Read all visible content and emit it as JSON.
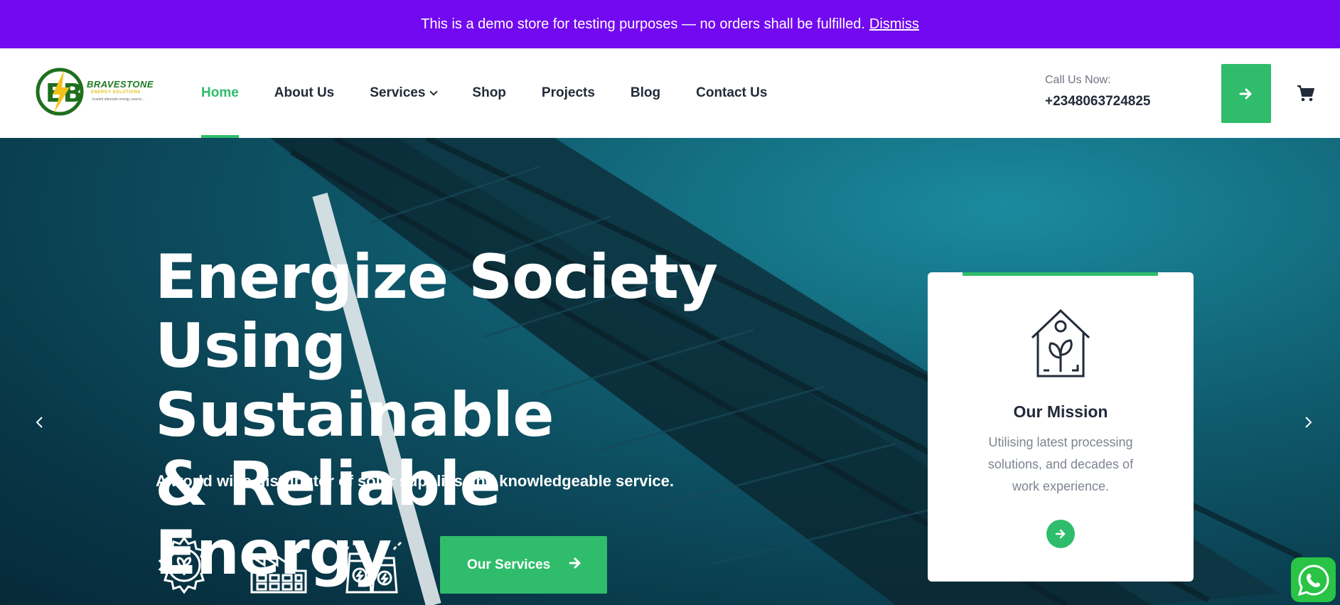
{
  "notice": {
    "text": "This is a demo store for testing purposes — no orders shall be fulfilled.",
    "dismiss": "Dismiss",
    "color": "#7209f0"
  },
  "logo": {
    "brand": "BRAVESTONE",
    "sub": "ENERGY SOLUTIONS",
    "tagline": "trusted alternate energy source..."
  },
  "nav": {
    "items": [
      "Home",
      "About Us",
      "Services",
      "Shop",
      "Projects",
      "Blog",
      "Contact Us"
    ],
    "active": "Home"
  },
  "contact": {
    "label": "Call Us Now:",
    "phone": "+2348063724825"
  },
  "hero": {
    "headline_1": "Energize Society",
    "headline_2": "Using Sustainable",
    "headline_3": "& Reliable Energy",
    "subline": "A world wide distributor of solar supplies and knowledgeable service.",
    "cta": "Our Services",
    "icons": [
      "gear-leaf-icon",
      "factory-leaf-icon",
      "power-plant-icon"
    ]
  },
  "card": {
    "title": "Our Mission",
    "description": "Utilising latest processing solutions, and decades of work experience.",
    "icon": "eco-house-icon"
  },
  "colors": {
    "accent": "#2fbd6b",
    "dark": "#222b3a"
  }
}
